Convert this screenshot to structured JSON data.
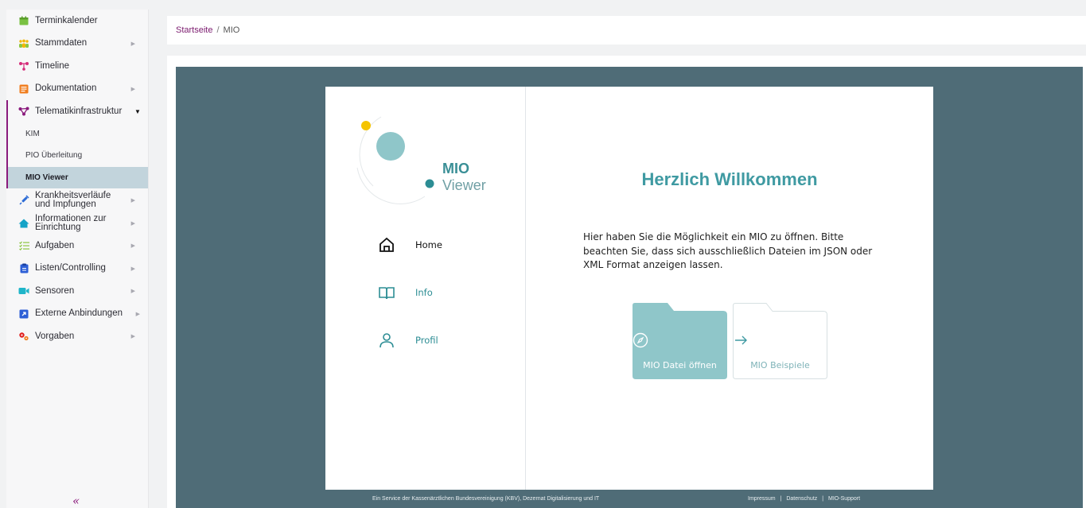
{
  "sidebar": {
    "items": [
      {
        "label": "Terminkalender",
        "icon": "calendar-icon",
        "color": "#7ac142"
      },
      {
        "label": "Stammdaten",
        "icon": "people-icon",
        "color": "#f2b705"
      },
      {
        "label": "Timeline",
        "icon": "timeline-icon",
        "color": "#d62d7a"
      },
      {
        "label": "Dokumentation",
        "icon": "document-icon",
        "color": "#f07d1e"
      },
      {
        "label": "Telematikinfrastruktur",
        "icon": "network-icon",
        "color": "#8a1a7c"
      },
      {
        "label": "Krankheitsverläufe und Impfungen",
        "icon": "syringe-icon",
        "color": "#2d6cd6"
      },
      {
        "label": "Informationen zur Einrichtung",
        "icon": "house-icon",
        "color": "#14a3c7"
      },
      {
        "label": "Aufgaben",
        "icon": "checklist-icon",
        "color": "#8cc63f"
      },
      {
        "label": "Listen/Controlling",
        "icon": "clipboard-icon",
        "color": "#2d5fd6"
      },
      {
        "label": "Sensoren",
        "icon": "camera-icon",
        "color": "#1fb5c9"
      },
      {
        "label": "Externe Anbindungen",
        "icon": "external-link-icon",
        "color": "#2d5fd6"
      },
      {
        "label": "Vorgaben",
        "icon": "gears-icon",
        "color": "#e02020"
      }
    ],
    "sub_items": [
      {
        "label": "KIM"
      },
      {
        "label": "PIO Überleitung"
      },
      {
        "label": "MIO Viewer"
      }
    ],
    "collapse_symbol": "«"
  },
  "breadcrumb": {
    "home": "Startseite",
    "separator": "/",
    "current": "MIO"
  },
  "viewer": {
    "logo_bold": "MIO",
    "logo_light": "Viewer",
    "nav": [
      {
        "label": "Home",
        "icon": "home-icon"
      },
      {
        "label": "Info",
        "icon": "book-icon"
      },
      {
        "label": "Profil",
        "icon": "user-icon"
      }
    ],
    "welcome": "Herzlich Willkommen",
    "intro": "Hier haben Sie die Möglichkeit ein MIO zu öffnen. Bitte beachten Sie, dass sich ausschließlich Dateien im JSON oder XML Format anzeigen lassen.",
    "open_button": "MIO Datei öffnen",
    "examples_button": "MIO Beispiele",
    "accent_color": "#3f9aa2"
  },
  "footer": {
    "service_text": "Ein Service der Kassenärztlichen Bundesvereinigung (KBV), Dezernat Digitalisierung und IT",
    "links": [
      "Impressum",
      "Datenschutz",
      "MIO-Support"
    ],
    "link_separator": "|"
  }
}
